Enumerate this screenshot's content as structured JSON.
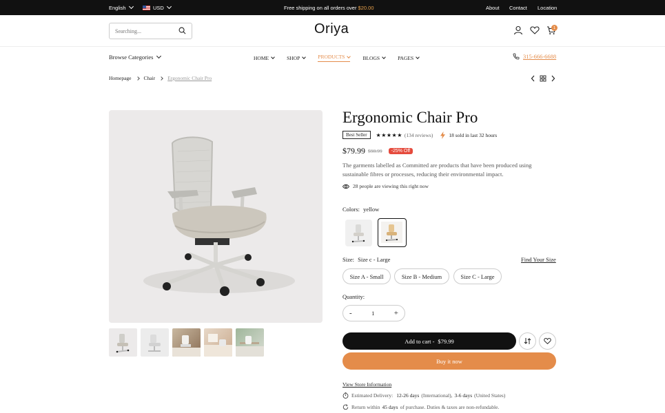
{
  "topbar": {
    "language": "English",
    "currency": "USD",
    "shipping_prefix": "Free shipping on all orders over ",
    "shipping_amount": "$20.00",
    "links": [
      "About",
      "Contact",
      "Location"
    ]
  },
  "header": {
    "search_placeholder": "Searching...",
    "logo": "Oriya",
    "cart_count": "1"
  },
  "nav": {
    "browse": "Browse Categories",
    "items": [
      "HOME",
      "SHOP",
      "PRODUCTS",
      "BLOGS",
      "PAGES"
    ],
    "active": "PRODUCTS",
    "phone": "315-666-6688"
  },
  "breadcrumb": [
    "Homepage",
    "Chair",
    "Ergonomic Chair Pro"
  ],
  "product": {
    "title": "Ergonomic Chair Pro",
    "badge": "Best Seller",
    "stars": "★★★★★",
    "rating": 5,
    "reviews": "(134 reviews)",
    "sold": "18 sold in last 32 hours",
    "price": "$79.99",
    "old_price": "$98.99",
    "discount": "-25% Off",
    "description": "The garments labelled as Committed are products that have been produced using sustainable fibres or processes, reducing their environmental impact.",
    "viewing": "28 people are viewing this right now",
    "colors_label": "Colors:",
    "color_value": "yellow",
    "size_label": "Size:",
    "size_value": "Size c - Large",
    "find_size": "Find Your Size",
    "sizes": [
      "Size A - Small",
      "Size B - Medium",
      "Size C - Large"
    ],
    "quantity_label": "Quantity:",
    "qty_minus": "-",
    "qty_plus": "+",
    "quantity": "1",
    "add_to_cart": "Add to cart -",
    "add_to_cart_price": "$79.99",
    "buy_now": "Buy it now",
    "store_info": "View Store Information",
    "delivery_label": "Estimated Delivery:",
    "delivery_intl": "12-26 days",
    "delivery_intl_note": "(International),",
    "delivery_us": "3-6 days",
    "delivery_us_note": "(United States)",
    "return_prefix": "Return within",
    "return_days": "45 days",
    "return_suffix": "of purchase. Duties & taxes are non-refundable."
  },
  "colors": {
    "accent": "#e48c4a",
    "sale": "#e54a3c",
    "dark": "#111111"
  }
}
